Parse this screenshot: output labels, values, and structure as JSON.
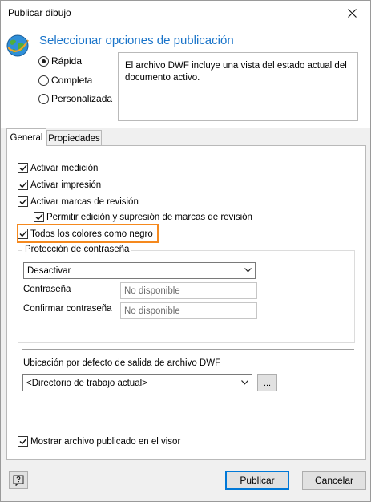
{
  "window": {
    "title": "Publicar dibujo"
  },
  "header": {
    "title": "Seleccionar opciones de publicación",
    "radios": [
      {
        "label": "Rápida",
        "selected": true
      },
      {
        "label": "Completa",
        "selected": false
      },
      {
        "label": "Personalizada",
        "selected": false
      }
    ],
    "description": "El archivo DWF incluye una vista del estado actual del documento activo."
  },
  "tabs": [
    {
      "label": "General",
      "active": true
    },
    {
      "label": "Propiedades",
      "active": false
    }
  ],
  "general": {
    "checkboxes": [
      {
        "label": "Activar medición",
        "checked": true
      },
      {
        "label": "Activar impresión",
        "checked": true
      },
      {
        "label": "Activar marcas de revisión",
        "checked": true
      },
      {
        "label": "Permitir edición y supresión de marcas de revisión",
        "checked": true
      },
      {
        "label": "Todos los colores como negro",
        "checked": true
      }
    ],
    "password_group": {
      "legend": "Protección de contraseña",
      "mode_value": "Desactivar",
      "password_label": "Contraseña",
      "password_value": "No disponible",
      "confirm_label": "Confirmar contraseña",
      "confirm_value": "No disponible"
    },
    "output_location": {
      "label": "Ubicación por defecto de salida de archivo DWF",
      "value": "<Directorio de trabajo actual>",
      "browse_label": "..."
    },
    "show_in_viewer": {
      "label": "Mostrar archivo publicado en el visor",
      "checked": true
    }
  },
  "footer": {
    "help_icon": "help-icon",
    "publish_label": "Publicar",
    "cancel_label": "Cancelar"
  },
  "colors": {
    "accent": "#1a74c9",
    "highlight": "#f5891e",
    "default_button": "#0078d7"
  }
}
